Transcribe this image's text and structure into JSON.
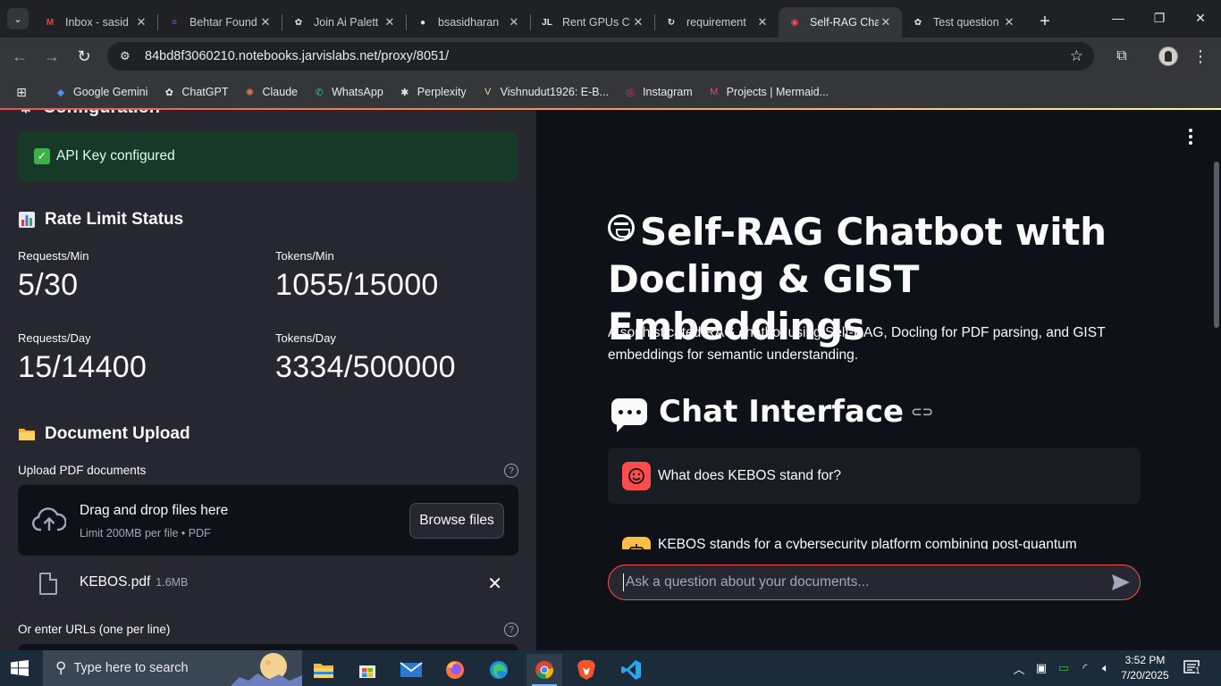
{
  "browser": {
    "tabs": [
      {
        "label": "Inbox - sasid",
        "icon": "gmail-icon",
        "color": "#ea4335",
        "glyph": "M"
      },
      {
        "label": "Behtar Found",
        "icon": "forms-icon",
        "color": "#7e57c2",
        "glyph": "≡"
      },
      {
        "label": "Join Ai Palett",
        "icon": "openai-icon",
        "color": "#e8eaed",
        "glyph": "✿"
      },
      {
        "label": "bsasidharan",
        "icon": "github-icon",
        "color": "#e8eaed",
        "glyph": "●"
      },
      {
        "label": "Rent GPUs C",
        "icon": "jarvislabs-icon",
        "color": "#e8eaed",
        "glyph": "JL"
      },
      {
        "label": "requirement",
        "icon": "jupyter-icon",
        "color": "#e8eaed",
        "glyph": "↻"
      },
      {
        "label": "Self-RAG Cha",
        "icon": "streamlit-icon",
        "color": "#ff4b4b",
        "glyph": "◉"
      },
      {
        "label": "Test question",
        "icon": "openai-icon",
        "color": "#e8eaed",
        "glyph": "✿"
      }
    ],
    "url": "84bd8f3060210.notebooks.jarvislabs.net/proxy/8051/",
    "bookmarks": [
      {
        "label": "Google Gemini",
        "icon": "gemini-icon",
        "color": "#4f8cf7",
        "glyph": "◆"
      },
      {
        "label": "ChatGPT",
        "icon": "openai-icon",
        "color": "#e8eaed",
        "glyph": "✿"
      },
      {
        "label": "Claude",
        "icon": "claude-icon",
        "color": "#d97757",
        "glyph": "✺"
      },
      {
        "label": "WhatsApp",
        "icon": "whatsapp-icon",
        "color": "#25d366",
        "glyph": "✆"
      },
      {
        "label": "Perplexity",
        "icon": "perplexity-icon",
        "color": "#e8eaed",
        "glyph": "✱"
      },
      {
        "label": "Vishnudut1926: E-B...",
        "icon": "vercel-icon",
        "color": "#e8d6a0",
        "glyph": "V"
      },
      {
        "label": "Instagram",
        "icon": "instagram-icon",
        "color": "#e1306c",
        "glyph": "◎"
      },
      {
        "label": "Projects | Mermaid...",
        "icon": "mermaid-icon",
        "color": "#ff3670",
        "glyph": "M"
      }
    ]
  },
  "sidebar": {
    "config_heading": "Configuration",
    "api_status": "API Key configured",
    "rate_heading": "Rate Limit Status",
    "metrics": [
      {
        "label": "Requests/Min",
        "value": "5/30"
      },
      {
        "label": "Tokens/Min",
        "value": "1055/15000"
      },
      {
        "label": "Requests/Day",
        "value": "15/14400"
      },
      {
        "label": "Tokens/Day",
        "value": "3334/500000"
      }
    ],
    "upload_heading": "Document Upload",
    "upload_label": "Upload PDF documents",
    "dropzone_title": "Drag and drop files here",
    "dropzone_sub": "Limit 200MB per file • PDF",
    "browse_label": "Browse files",
    "file_name": "KEBOS.pdf",
    "file_size": "1.6MB",
    "url_label": "Or enter URLs (one per line)"
  },
  "main": {
    "title": "Self-RAG Chatbot with Docling & GIST Embeddings",
    "description": "A sophisticated RAG chatbot using Self-RAG, Docling for PDF parsing, and GIST embeddings for semantic understanding.",
    "chat_heading": "Chat Interface",
    "user_message": "What does KEBOS stand for?",
    "bot_message": "KEBOS stands for a cybersecurity platform combining post-quantum",
    "input_placeholder": "Ask a question about your documents..."
  },
  "taskbar": {
    "search_placeholder": "Type here to search",
    "time": "3:52 PM",
    "date": "7/20/2025",
    "notification_count": "1"
  },
  "colors": {
    "accent": "#ff4b4b",
    "success_bg": "#173928",
    "sidebar_bg": "#262730",
    "main_bg": "#0e1117"
  }
}
